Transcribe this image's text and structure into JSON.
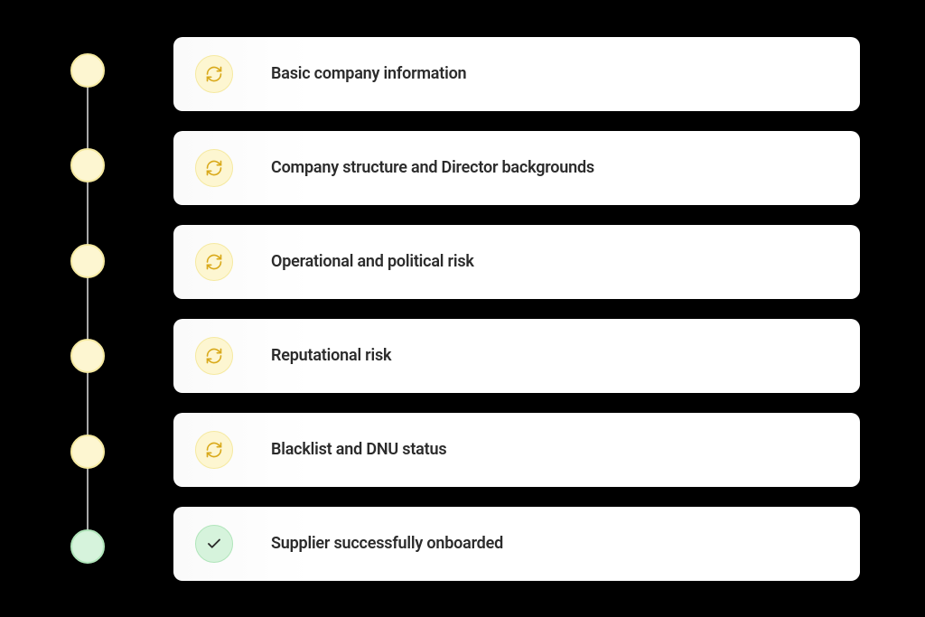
{
  "steps": [
    {
      "label": "Basic company information",
      "status": "pending",
      "icon": "refresh"
    },
    {
      "label": "Company structure and Director backgrounds",
      "status": "pending",
      "icon": "refresh"
    },
    {
      "label": "Operational and political risk",
      "status": "pending",
      "icon": "refresh"
    },
    {
      "label": "Reputational risk",
      "status": "pending",
      "icon": "refresh"
    },
    {
      "label": "Blacklist and DNU status",
      "status": "pending",
      "icon": "refresh"
    },
    {
      "label": "Supplier successfully onboarded",
      "status": "complete",
      "icon": "check"
    }
  ],
  "colors": {
    "pending_bg": "#FDF6D1",
    "pending_border": "#F5E9A0",
    "pending_icon": "#D9A91A",
    "complete_bg": "#D6F3DC",
    "complete_border": "#B0E5BA",
    "complete_icon": "#2B2B2B"
  }
}
